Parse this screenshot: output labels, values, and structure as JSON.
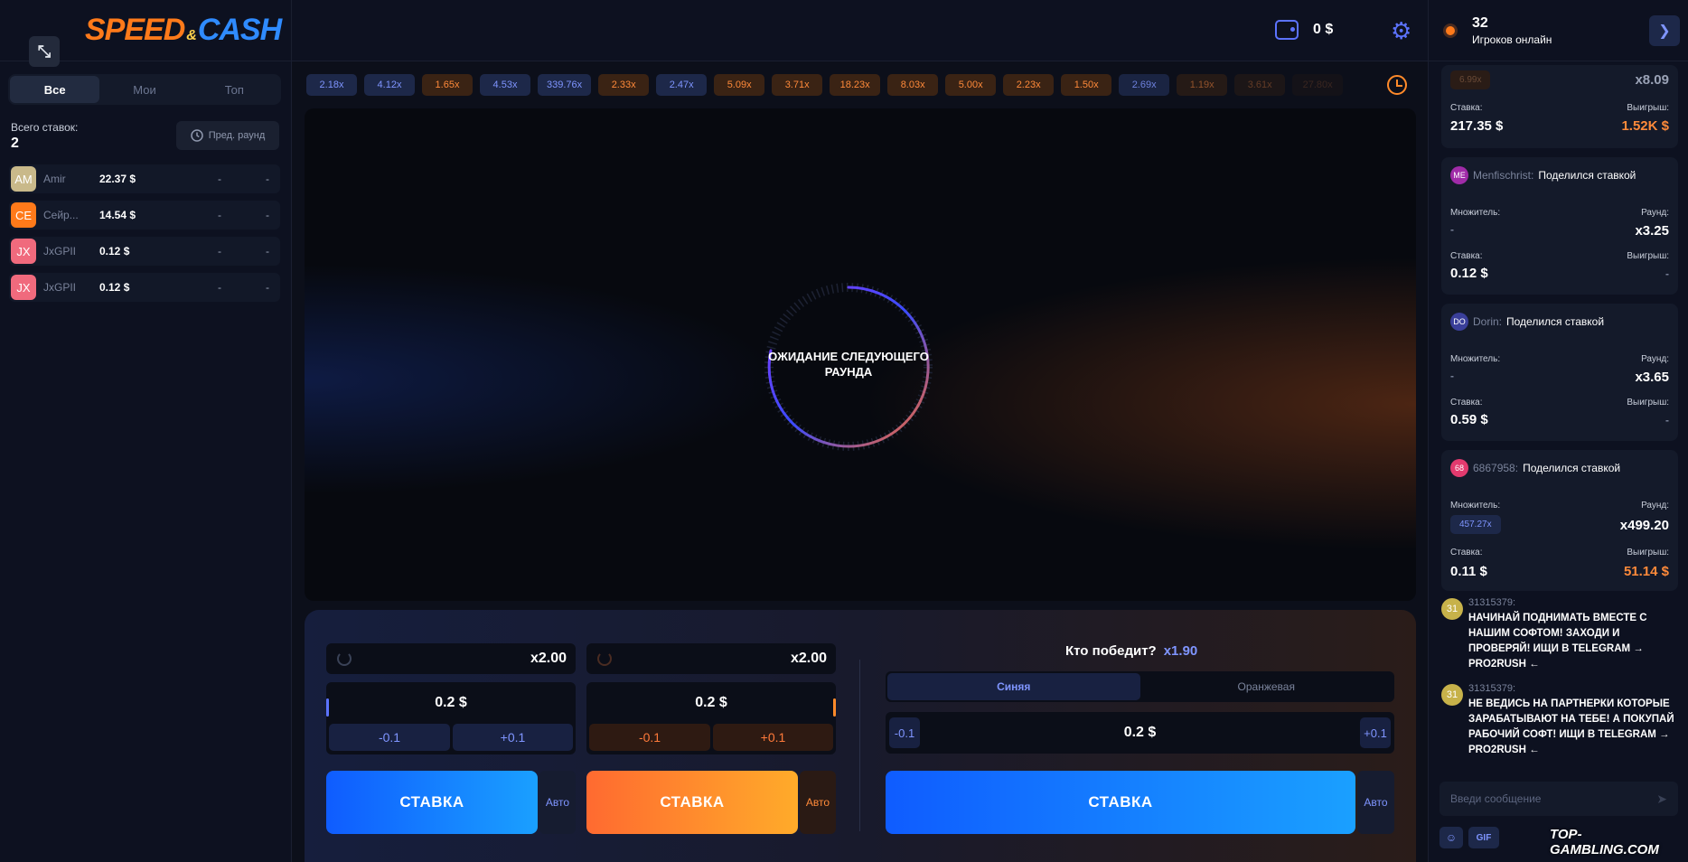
{
  "logo": {
    "speed": "SPEED",
    "amp": "&",
    "cash": "CASH"
  },
  "left": {
    "tabs": [
      "Все",
      "Мои",
      "Топ"
    ],
    "total_label": "Всего ставок:",
    "total_value": "2",
    "prev_round": "Пред. раунд",
    "bets": [
      {
        "initials": "AM",
        "color": "#c9b98a",
        "name": "Amir",
        "amount": "22.37 $",
        "mult": "-",
        "win": "-"
      },
      {
        "initials": "CE",
        "color": "#ff7a1a",
        "name": "Сейр...",
        "amount": "14.54 $",
        "mult": "-",
        "win": "-"
      },
      {
        "initials": "JX",
        "color": "#f06a7d",
        "name": "JxGPII",
        "amount": "0.12 $",
        "mult": "-",
        "win": "-"
      },
      {
        "initials": "JX",
        "color": "#f06a7d",
        "name": "JxGPII",
        "amount": "0.12 $",
        "mult": "-",
        "win": "-"
      }
    ]
  },
  "topbar": {
    "balance": "0 $"
  },
  "history": [
    {
      "v": "2.18x",
      "c": "blue"
    },
    {
      "v": "4.12x",
      "c": "blue"
    },
    {
      "v": "1.65x",
      "c": "orange"
    },
    {
      "v": "4.53x",
      "c": "blue"
    },
    {
      "v": "339.76x",
      "c": "blue"
    },
    {
      "v": "2.33x",
      "c": "orange"
    },
    {
      "v": "2.47x",
      "c": "blue"
    },
    {
      "v": "5.09x",
      "c": "orange"
    },
    {
      "v": "3.71x",
      "c": "orange"
    },
    {
      "v": "18.23x",
      "c": "orange"
    },
    {
      "v": "8.03x",
      "c": "orange"
    },
    {
      "v": "5.00x",
      "c": "orange"
    },
    {
      "v": "2.23x",
      "c": "orange"
    },
    {
      "v": "1.50x",
      "c": "orange"
    },
    {
      "v": "2.69x",
      "c": "blue"
    },
    {
      "v": "1.19x",
      "c": "orange"
    },
    {
      "v": "3.61x",
      "c": "orange"
    },
    {
      "v": "27.80x",
      "c": "orange"
    }
  ],
  "game": {
    "waiting_text": "ОЖИДАНИЕ СЛЕДУЮЩЕГО РАУНДА"
  },
  "panel": {
    "blue": {
      "mult": "x2.00",
      "amount": "0.2 $",
      "minus": "-0.1",
      "plus": "+0.1",
      "bet": "СТАВКА",
      "auto": "Авто"
    },
    "orange": {
      "mult": "x2.00",
      "amount": "0.2 $",
      "minus": "-0.1",
      "plus": "+0.1",
      "bet": "СТАВКА",
      "auto": "Авто"
    },
    "duel": {
      "question": "Кто победит?",
      "coef": "x1.90",
      "tab_blue": "Синяя",
      "tab_orange": "Оранжевая",
      "minus": "-0.1",
      "amount": "0.2 $",
      "plus": "+0.1",
      "bet": "СТАВКА",
      "auto": "Авто"
    }
  },
  "right": {
    "online_count": "32",
    "online_label": "Игроков онлайн",
    "top_card": {
      "pill": "6.99x",
      "round": "x8.09",
      "bet_label": "Ставка:",
      "bet": "217.35 $",
      "win_label": "Выигрыш:",
      "win": "1.52K $"
    },
    "cards": [
      {
        "initials": "ME",
        "color": "#a02ba8",
        "user": "Menfischrist:",
        "action": "Поделился ставкой",
        "mult_label": "Множитель:",
        "mult": "-",
        "round_label": "Раунд:",
        "round": "x3.25",
        "bet_label": "Ставка:",
        "bet": "0.12 $",
        "win_label": "Выигрыш:",
        "win": "-"
      },
      {
        "initials": "DO",
        "color": "#3a3f9a",
        "user": "Dorin:",
        "action": "Поделился ставкой",
        "mult_label": "Множитель:",
        "mult": "-",
        "round_label": "Раунд:",
        "round": "x3.65",
        "bet_label": "Ставка:",
        "bet": "0.59 $",
        "win_label": "Выигрыш:",
        "win": "-"
      },
      {
        "initials": "68",
        "color": "#e33a6e",
        "user": "6867958:",
        "action": "Поделился ставкой",
        "mult_label": "Множитель:",
        "mult": "457.27x",
        "round_label": "Раунд:",
        "round": "x499.20",
        "bet_label": "Ставка:",
        "bet": "0.11 $",
        "win_label": "Выигрыш:",
        "win": "51.14 $"
      }
    ],
    "messages": [
      {
        "initials": "31",
        "from": "31315379:",
        "text": "НАЧИНАЙ ПОДНИМАТЬ ВМЕСТЕ С НАШИМ СОФТОМ! ЗАХОДИ И ПРОВЕРЯЙ! ИЩИ В TELEGRAM → PRO2RUSH ←"
      },
      {
        "initials": "31",
        "from": "31315379:",
        "text": "НЕ ВЕДИСЬ НА ПАРТНЕРКИ КОТОРЫЕ ЗАРАБАТЫВАЮТ НА ТЕБЕ! А ПОКУПАЙ РАБОЧИЙ СОФТ! ИЩИ В TELEGRAM → PRO2RUSH ←"
      }
    ],
    "chat_placeholder": "Введи сообщение",
    "gif": "GIF"
  },
  "watermark": "TOP-GAMBLING.COM"
}
